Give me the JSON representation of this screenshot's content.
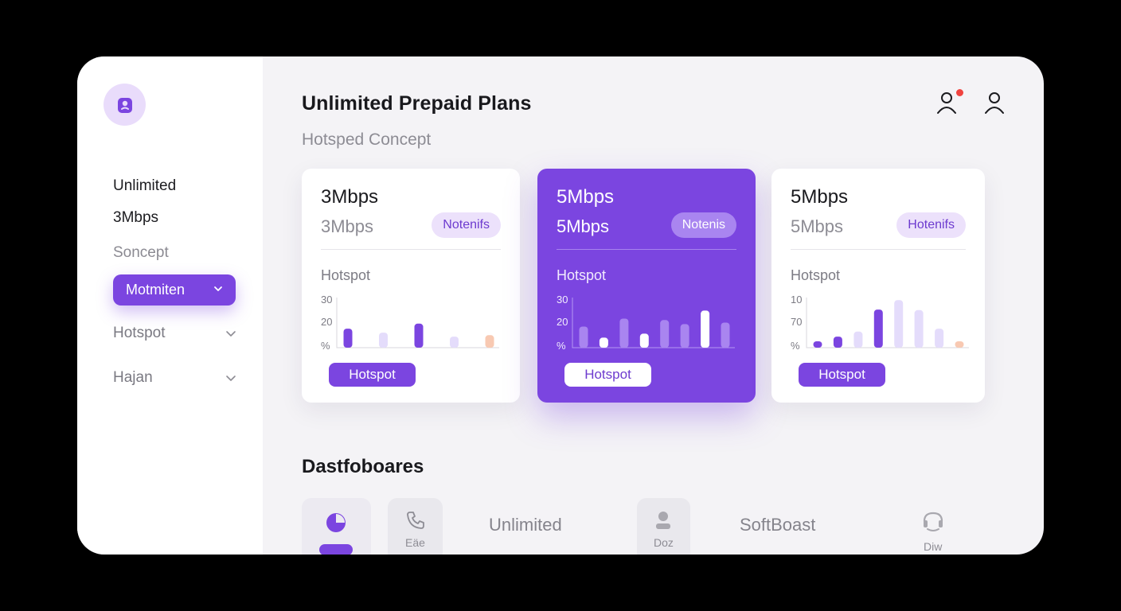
{
  "sidebar": {
    "items": [
      {
        "label": "Unlimited"
      },
      {
        "label": "3Mbps"
      },
      {
        "label": "Soncept"
      }
    ],
    "selected": {
      "label": "Motmiten"
    },
    "dropdowns": [
      {
        "label": "Hotspot"
      },
      {
        "label": "Hajan"
      }
    ]
  },
  "header": {
    "title": "Unlimited Prepaid Plans",
    "subtitle": "Hotsped Concept",
    "icons": [
      "user-icon",
      "user-icon"
    ],
    "notification_color": "#f0433f"
  },
  "accent": "#7b45e0",
  "plans": [
    {
      "title": "3Mbps",
      "subtitle": "3Mbps",
      "badge": "Notenifs",
      "section_label": "Hotspot",
      "y_labels": [
        "30",
        "20",
        "%"
      ],
      "button": "Hotspot",
      "active": false,
      "chart_data": {
        "type": "bar",
        "values": [
          0.38,
          0.3,
          0.48,
          0.22,
          0.25
        ],
        "colors": [
          "#7b45e0",
          "#e4dcfb",
          "#7b45e0",
          "#e4dcfb",
          "#f8c9b2"
        ]
      }
    },
    {
      "title": "5Mbps",
      "subtitle": "5Mbps",
      "badge": "Notenis",
      "section_label": "Hotspot",
      "y_labels": [
        "30",
        "20",
        "%"
      ],
      "button": "Hotspot",
      "active": true,
      "chart_data": {
        "type": "bar",
        "values": [
          0.42,
          0.2,
          0.58,
          0.28,
          0.55,
          0.47,
          0.74,
          0.5
        ],
        "colors": [
          "#a985f0",
          "#ffffff",
          "#a985f0",
          "#ffffff",
          "#a985f0",
          "#a985f0",
          "#ffffff",
          "#a985f0"
        ]
      }
    },
    {
      "title": "5Mbps",
      "subtitle": "5Mbps",
      "badge": "Hotenifs",
      "section_label": "Hotspot",
      "y_labels": [
        "10",
        "70",
        "%"
      ],
      "button": "Hotspot",
      "active": false,
      "chart_data": {
        "type": "bar",
        "values": [
          0.12,
          0.22,
          0.32,
          0.76,
          0.95,
          0.75,
          0.38,
          0.06
        ],
        "colors": [
          "#7b45e0",
          "#7b45e0",
          "#e4dcfb",
          "#7b45e0",
          "#e4dcfb",
          "#e4dcfb",
          "#e4dcfb",
          "#f8c9b2"
        ]
      }
    }
  ],
  "dashboard": {
    "title": "Dastfoboares",
    "items": [
      {
        "icon": "pie-icon",
        "label": ""
      },
      {
        "icon": "phone-icon",
        "label": "Eäe"
      },
      {
        "label": "Unlimited"
      },
      {
        "icon": "person-icon",
        "label": "Doz"
      },
      {
        "label": "SoftBoast"
      },
      {
        "icon": "headset-icon",
        "label": "Diw"
      }
    ]
  }
}
